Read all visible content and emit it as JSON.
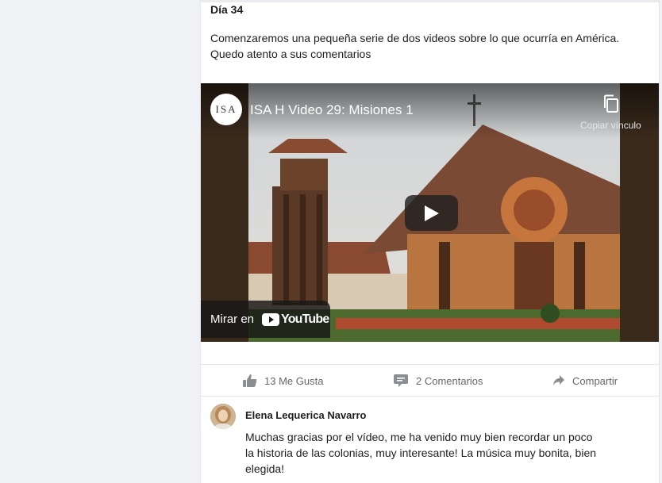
{
  "post": {
    "title": "Día 34",
    "body": "Comenzaremos una pequeña serie de dos videos sobre lo que ocurría en América. Quedo atento a sus comentarios"
  },
  "video": {
    "channel_logo_text": "ISA",
    "title": "ISA H Video 29: Misiones 1",
    "copy_link_label": "Copiar vínculo",
    "watch_on_label": "Mirar en",
    "youtube_label": "YouTube"
  },
  "actions": {
    "likes": "13 Me Gusta",
    "comments": "2 Comentarios",
    "share": "Compartir"
  },
  "comments": [
    {
      "author": "Elena Lequerica Navarro",
      "text": "Muchas gracias por el vídeo, me ha venido muy bien recordar un poco la historia de las colonias, muy interesante! La música muy bonita, bien elegida!"
    }
  ],
  "colors": {
    "action_text": "#65676b",
    "youtube_red": "#ff0000",
    "background": "#f0f1f5"
  }
}
